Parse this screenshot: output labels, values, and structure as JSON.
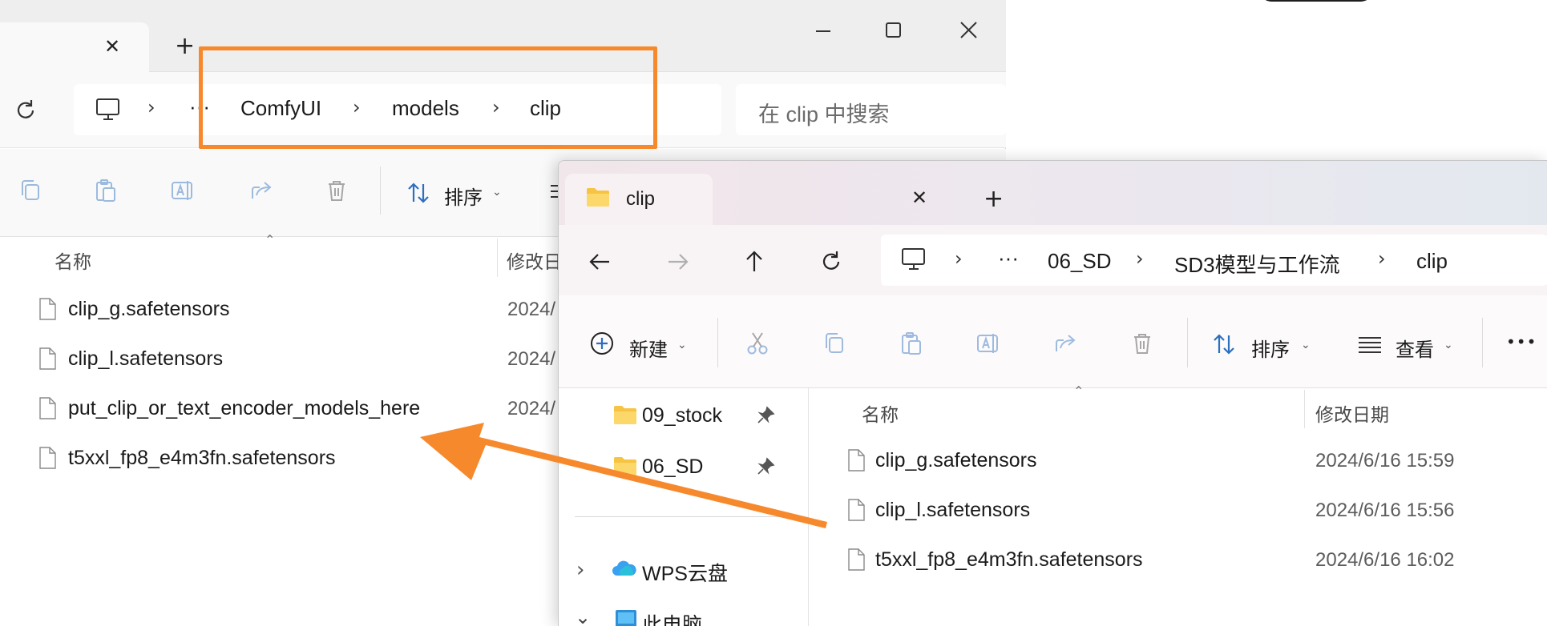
{
  "back_window": {
    "tab_close_glyph": "✕",
    "new_tab_glyph": "+",
    "window_controls": {
      "minimize": "—",
      "maximize": "☐",
      "close": "✕"
    },
    "breadcrumb": {
      "more": "···",
      "items": [
        "ComfyUI",
        "models",
        "clip"
      ]
    },
    "search_placeholder": "在 clip 中搜索",
    "sort_label": "排序",
    "columns": {
      "name": "名称",
      "modified": "修改日"
    },
    "files": [
      {
        "name": "clip_g.safetensors",
        "date": "2024/"
      },
      {
        "name": "clip_l.safetensors",
        "date": "2024/"
      },
      {
        "name": "put_clip_or_text_encoder_models_here",
        "date": "2024/"
      },
      {
        "name": "t5xxl_fp8_e4m3fn.safetensors",
        "date": "2024/"
      }
    ]
  },
  "front_window": {
    "tab_title": "clip",
    "tab_close_glyph": "✕",
    "new_tab_glyph": "+",
    "breadcrumb": {
      "more": "···",
      "items": [
        "06_SD",
        "SD3模型与工作流",
        "clip"
      ]
    },
    "commands": {
      "new": "新建",
      "sort": "排序",
      "view": "查看",
      "more": "•••"
    },
    "nav_items": [
      {
        "label": "09_stock",
        "pinned": true
      },
      {
        "label": "06_SD",
        "pinned": true
      },
      {
        "label": "WPS云盘",
        "expand": "›"
      },
      {
        "label": "此电脑",
        "expand": "⌄"
      }
    ],
    "columns": {
      "name": "名称",
      "modified": "修改日期"
    },
    "files": [
      {
        "name": "clip_g.safetensors",
        "date": "2024/6/16 15:59"
      },
      {
        "name": "clip_l.safetensors",
        "date": "2024/6/16 15:56"
      },
      {
        "name": "t5xxl_fp8_e4m3fn.safetensors",
        "date": "2024/6/16 16:02"
      }
    ]
  },
  "colors": {
    "annotation": "#f7892d",
    "folder": "#f6c343",
    "accent": "#2d6fbf"
  }
}
